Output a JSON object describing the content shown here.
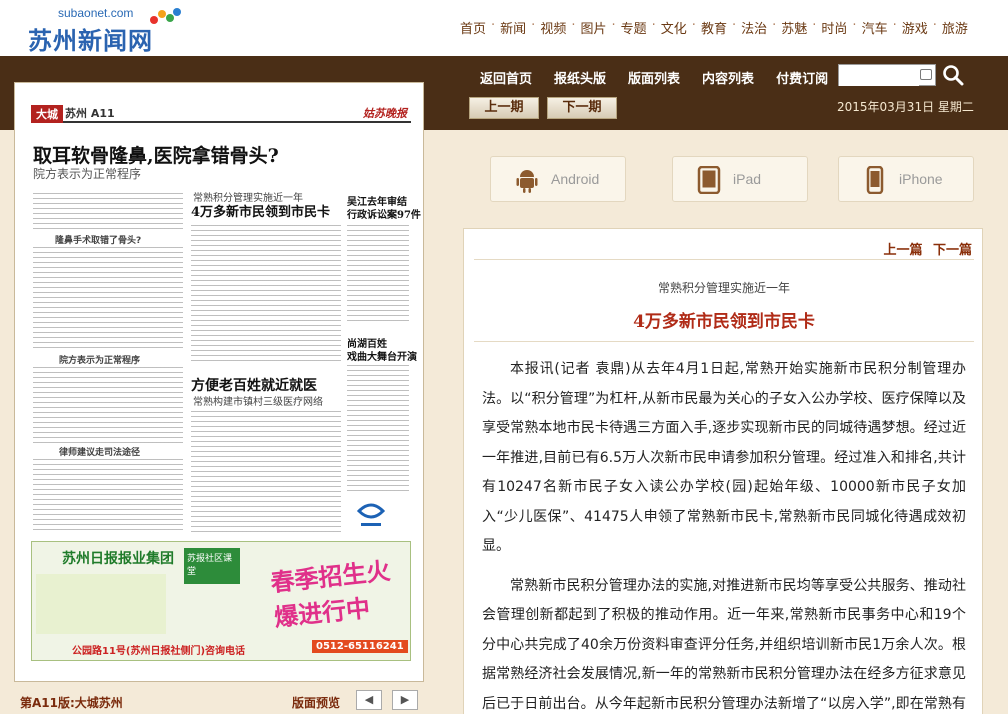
{
  "site": {
    "logo_url": "subaonet.com",
    "logo_name": "苏州新闻网",
    "topnav": [
      "首页",
      "新闻",
      "视频",
      "图片",
      "专题",
      "文化",
      "教育",
      "法治",
      "苏魅",
      "时尚",
      "汽车",
      "游戏",
      "旅游"
    ]
  },
  "mainnav": [
    "返回首页",
    "报纸头版",
    "版面列表",
    "内容列表",
    "付费订阅"
  ],
  "search": {
    "value": "",
    "placeholder": ""
  },
  "issue": {
    "prev": "上一期",
    "next": "下一期",
    "date": "2015年03月31日 星期二"
  },
  "paper": {
    "section": "大城",
    "page": "苏州 A11",
    "brand": "姑苏晚报",
    "headline": "取耳软骨隆鼻,医院拿错骨头?",
    "subhead": "院方表示为正常程序",
    "h_a": "常熟积分管理实施近一年",
    "h_b": "4万多新市民领到市民卡",
    "h_c": "吴江去年审结",
    "h_c2": "行政诉讼案97件",
    "h_d": "方便老百姓就近就医",
    "h_d2": "常熟构建市镇村三级医疗网络",
    "h_e": "尚湖百姓",
    "h_e2": "戏曲大舞台开演",
    "h_f": "隆鼻手术取错了骨头?",
    "h_g": "院方表示为正常程序",
    "h_h": "律师建议走司法途径",
    "ad_brand": "苏州日报报业集团",
    "ad_mid": "苏报社区课堂",
    "ad_slogan": "春季招生火爆进行中",
    "ad_addr": "公园路11号(苏州日报社侧门)咨询电话",
    "ad_tel": "0512-65116241"
  },
  "pagebar": {
    "label": "第A11版:大城苏州",
    "preview": "版面预览",
    "prev_arrow": "◀",
    "next_arrow": "▶"
  },
  "platforms": [
    {
      "name": "Android",
      "icon": "android-icon"
    },
    {
      "name": "iPad",
      "icon": "tablet-icon"
    },
    {
      "name": "iPhone",
      "icon": "phone-icon"
    }
  ],
  "article": {
    "prev": "上一篇",
    "next": "下一篇",
    "kicker": "常熟积分管理实施近一年",
    "title": "4万多新市民领到市民卡",
    "paragraphs": [
      "本报讯(记者 袁鼎)从去年4月1日起,常熟开始实施新市民积分制管理办法。以“积分管理”为杠杆,从新市民最为关心的子女入公办学校、医疗保障以及享受常熟本地市民卡待遇三方面入手,逐步实现新市民的同城待遇梦想。经过近一年推进,目前已有6.5万人次新市民申请参加积分管理。经过准入和排名,共计有10247名新市民子女入读公办学校(园)起始年级、10000新市民子女加入“少儿医保”、41475人申领了常熟新市民卡,常熟新市民同城化待遇成效初显。",
      "常熟新市民积分管理办法的实施,对推进新市民均等享受公共服务、推动社会管理创新都起到了积极的推动作用。近一年来,常熟新市民事务中心和19个分中心共完成了40余万份资料审查评分任务,并组织培训新市民1万余人次。根据常熟经济社会发展情况,新一年的常熟新市民积分管理办法在经多方征求意见后已于日前出台。从今年起新市民积分管理办法新增了“以房入学”,即在常熟有产权房的新市民,需参加积分管理但不予排名,可凭积分入"
    ]
  }
}
